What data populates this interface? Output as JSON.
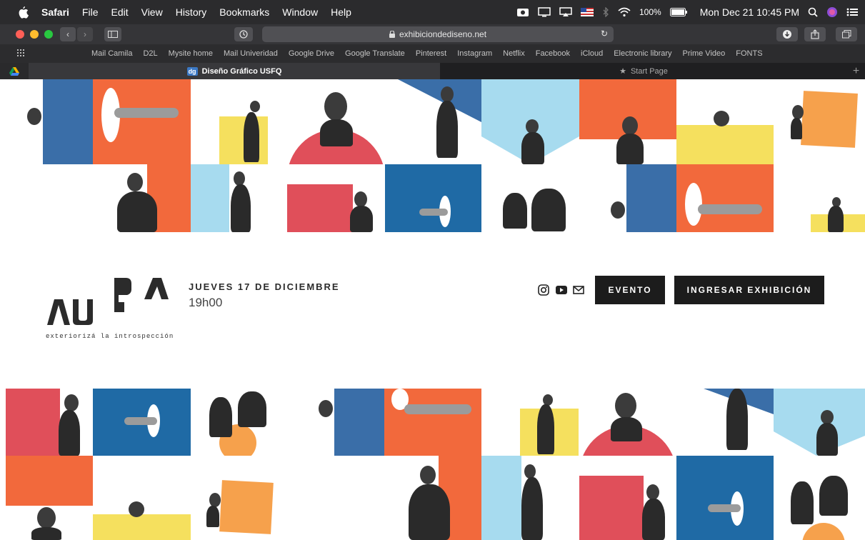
{
  "menubar": {
    "app_name": "Safari",
    "items": [
      "File",
      "Edit",
      "View",
      "History",
      "Bookmarks",
      "Window",
      "Help"
    ],
    "battery": "100%",
    "datetime": "Mon Dec 21 10:45 PM"
  },
  "toolbar": {
    "url": "exhibiciondediseno.net"
  },
  "bookmarks": {
    "items": [
      "Mail Camila",
      "D2L",
      "Mysite home",
      "Mail Univeridad",
      "Google Drive",
      "Google Translate",
      "Pinterest",
      "Instagram",
      "Netflix",
      "Facebook",
      "iCloud",
      "Electronic library",
      "Prime Video",
      "FONTS"
    ]
  },
  "tabs": {
    "active_icon_text": "dg",
    "active_title": "Diseño Gráfico USFQ",
    "second_title": "Start Page"
  },
  "hero": {
    "logo_tagline": "exteriorizá la introspección",
    "date": "JUEVES 17 DE DICIEMBRE",
    "time": "19h00",
    "evento_label": "EVENTO",
    "ingresar_label": "INGRESAR EXHIBICIÓN"
  },
  "colors": {
    "orange": "#f2693c",
    "blue": "#3a6ea8",
    "deepblue": "#1f6aa5",
    "yellow": "#f5e05e",
    "lightblue": "#a7dbef",
    "red": "#e04f5a",
    "lightorange": "#f6a14c"
  }
}
